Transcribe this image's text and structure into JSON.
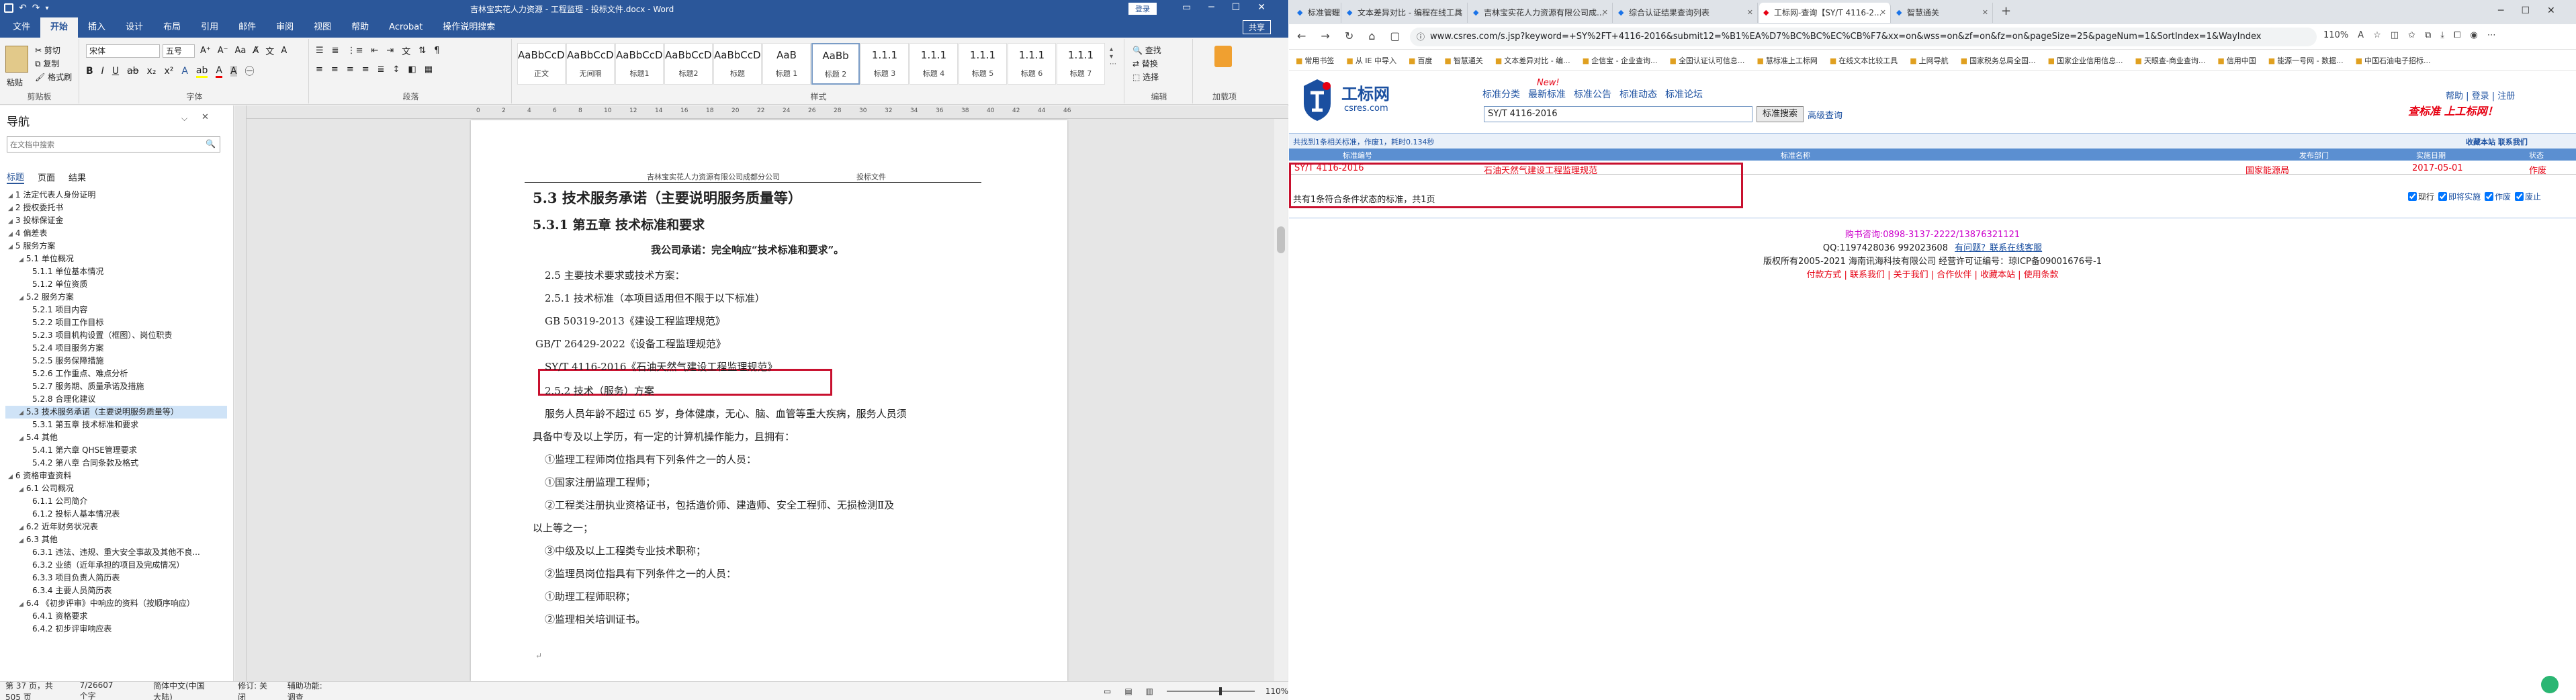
{
  "word": {
    "title_bar": {
      "file_name": "吉林宝实花人力资源 - 工程监理 - 投标文件.docx - Word",
      "login": "登录",
      "share": "共享"
    },
    "tabs": [
      "文件",
      "开始",
      "插入",
      "设计",
      "布局",
      "引用",
      "邮件",
      "审阅",
      "视图",
      "帮助",
      "Acrobat",
      "操作说明搜索"
    ],
    "active_tab": "开始",
    "ribbon": {
      "clipboard": {
        "paste": "粘贴",
        "cut": "剪切",
        "copy": "复制",
        "format_painter": "格式刷",
        "label": "剪贴板"
      },
      "font": {
        "name": "宋体",
        "size": "五号",
        "label": "字体",
        "bold": "B",
        "italic": "I",
        "underline": "U"
      },
      "paragraph": {
        "label": "段落"
      },
      "styles": {
        "label": "样式",
        "items": [
          {
            "sample": "AaBbCcDd",
            "name": "正文"
          },
          {
            "sample": "AaBbCcDd",
            "name": "无间隔"
          },
          {
            "sample": "AaBbCcDd",
            "name": "标题1"
          },
          {
            "sample": "AaBbCcDd",
            "name": "标题2"
          },
          {
            "sample": "AaBbCcDd",
            "name": "标题"
          },
          {
            "sample": "AaB",
            "name": "标题 1"
          },
          {
            "sample": "AaBb",
            "name": "标题 2"
          },
          {
            "sample": "1.1.1",
            "name": "标题 3"
          },
          {
            "sample": "1.1.1",
            "name": "标题 4"
          },
          {
            "sample": "1.1.1",
            "name": "标题 5"
          },
          {
            "sample": "1.1.1",
            "name": "标题 6"
          },
          {
            "sample": "1.1.1",
            "name": "标题 7"
          }
        ]
      },
      "editing": {
        "find": "查找",
        "replace": "替换",
        "select": "选择",
        "label": "编辑"
      },
      "addins": {
        "label": "加载项"
      }
    },
    "nav": {
      "title": "导航",
      "search_placeholder": "在文档中搜索",
      "tabs": [
        "标题",
        "页面",
        "结果"
      ],
      "items": [
        {
          "text": "1 法定代表人身份证明",
          "level": 0,
          "selected": false
        },
        {
          "text": "2 授权委托书",
          "level": 0,
          "selected": false
        },
        {
          "text": "3 投标保证金",
          "level": 0,
          "selected": false
        },
        {
          "text": "4 偏差表",
          "level": 0,
          "selected": false
        },
        {
          "text": "5 服务方案",
          "level": 0,
          "selected": false
        },
        {
          "text": "5.1 单位概况",
          "level": 1,
          "selected": false
        },
        {
          "text": "5.1.1 单位基本情况",
          "level": 2,
          "selected": false
        },
        {
          "text": "5.1.2 单位资质",
          "level": 2,
          "selected": false
        },
        {
          "text": "5.2 服务方案",
          "level": 1,
          "selected": false
        },
        {
          "text": "5.2.1 项目内容",
          "level": 2,
          "selected": false
        },
        {
          "text": "5.2.2 项目工作目标",
          "level": 2,
          "selected": false
        },
        {
          "text": "5.2.3 项目机构设置（框图）、岗位职责",
          "level": 2,
          "selected": false
        },
        {
          "text": "5.2.4 项目服务方案",
          "level": 2,
          "selected": false
        },
        {
          "text": "5.2.5 服务保障措施",
          "level": 2,
          "selected": false
        },
        {
          "text": "5.2.6 工作重点、难点分析",
          "level": 2,
          "selected": false
        },
        {
          "text": "5.2.7 服务期、质量承诺及措施",
          "level": 2,
          "selected": false
        },
        {
          "text": "5.2.8 合理化建议",
          "level": 2,
          "selected": false
        },
        {
          "text": "5.3 技术服务承诺（主要说明服务质量等）",
          "level": 1,
          "selected": true
        },
        {
          "text": "5.3.1 第五章 技术标准和要求",
          "level": 2,
          "selected": false
        },
        {
          "text": "5.4 其他",
          "level": 1,
          "selected": false
        },
        {
          "text": "5.4.1 第六章 QHSE管理要求",
          "level": 2,
          "selected": false
        },
        {
          "text": "5.4.2 第八章 合同条款及格式",
          "level": 2,
          "selected": false
        },
        {
          "text": "6 资格审查资料",
          "level": 0,
          "selected": false
        },
        {
          "text": "6.1 公司概况",
          "level": 1,
          "selected": false
        },
        {
          "text": "6.1.1 公司简介",
          "level": 2,
          "selected": false
        },
        {
          "text": "6.1.2 投标人基本情况表",
          "level": 2,
          "selected": false
        },
        {
          "text": "6.2 近年财务状况表",
          "level": 1,
          "selected": false
        },
        {
          "text": "6.3 其他",
          "level": 1,
          "selected": false
        },
        {
          "text": "6.3.1 违法、违规、重大安全事故及其他不良...",
          "level": 2,
          "selected": false
        },
        {
          "text": "6.3.2 业绩（近年承担的项目及完成情况）",
          "level": 2,
          "selected": false
        },
        {
          "text": "6.3.3 项目负责人简历表",
          "level": 2,
          "selected": false
        },
        {
          "text": "6.3.4 主要人员简历表",
          "level": 2,
          "selected": false
        },
        {
          "text": "6.4 《初步评审》中响应的资料（按顺序响应）",
          "level": 1,
          "selected": false
        },
        {
          "text": "6.4.1 资格要求",
          "level": 2,
          "selected": false
        },
        {
          "text": "6.4.2 初步评审响应表",
          "level": 2,
          "selected": false
        }
      ]
    },
    "document": {
      "header": "吉林宝实花人力资源有限公司成都分公司",
      "header_right": "投标文件",
      "h2": "5.3 技术服务承诺（主要说明服务质量等）",
      "h3": "5.3.1 第五章  技术标准和要求",
      "promise": "我公司承诺：完全响应“技术标准和要求”。",
      "lines": [
        "2.5 主要技术要求或技术方案：",
        "2.5.1 技术标准（本项目适用但不限于以下标准）",
        "GB 50319-2013《建设工程监理规范》",
        "GB/T 26429-2022《设备工程监理规范》",
        "SY/T  4116-2016《石油天然气建设工程监理规范》",
        "2.5.2 技术（服务）方案",
        "服务人员年龄不超过 65 岁，身体健康，无心、脑、血管等重大疾病，服务人员须",
        "具备中专及以上学历，有一定的计算机操作能力，且拥有：",
        "①监理工程师岗位指具有下列条件之一的人员：",
        "①国家注册监理工程师；",
        "②工程类注册执业资格证书，包括造价师、建造师、安全工程师、无损检测Ⅱ及",
        "以上等之一；",
        "③中级及以上工程类专业技术职称；",
        "②监理员岗位指具有下列条件之一的人员：",
        "①助理工程师职称；",
        "②监理相关培训证书。"
      ]
    },
    "status": {
      "page": "第 37 页，共 505 页",
      "words": "7/26607 个字",
      "lang": "简体中文(中国大陆)",
      "track": "修订: 关闭",
      "access": "辅助功能: 调查",
      "zoom": "110%"
    }
  },
  "browser": {
    "tabs": [
      {
        "title": "标准管理 - ",
        "active": false
      },
      {
        "title": "文本差异对比 - 编程在线工具",
        "active": false
      },
      {
        "title": "吉林宝实花人力资源有限公司成...",
        "active": false
      },
      {
        "title": "综合认证结果查询列表",
        "active": false
      },
      {
        "title": "工标网-查询【SY/T 4116-2...",
        "active": true
      },
      {
        "title": "智慧通关",
        "active": false
      }
    ],
    "new_tab": "+",
    "url": "www.csres.com/s.jsp?keyword=+SY%2FT+4116-2016&submit12=%B1%EA%D7%BC%BC%EC%CB%F7&xx=on&wss=on&zf=on&fz=on&pageSize=25&pageNum=1&SortIndex=1&WayIndex",
    "zoom": "110%",
    "bookmarks": [
      "常用书签",
      "从 IE 中导入",
      "百度",
      "智慧通关",
      "文本差异对比 - 编...",
      "企信宝 - 企业查询...",
      "全国认证认可信息...",
      "慧标准上工标网",
      "在线文本比较工具",
      "上网导航",
      "国家税务总局全国...",
      "国家企业信用信息...",
      "天眼查-商业查询...",
      "信用中国",
      "能源一号网 - 数据...",
      "中国石油电子招标..."
    ],
    "site": {
      "logo_cn": "工标网",
      "logo_en": "csres.com",
      "nav": [
        "标准分类",
        "最新标准",
        "标准公告",
        "标准动态",
        "标准论坛"
      ],
      "new_badge": "New!",
      "search_value": "SY/T 4116-2016",
      "search_button": "标准搜索",
      "advanced": "高级查询",
      "top_links": "帮助 | 登录 | 注册",
      "slogan": "查标准  上工标网！",
      "result_summary": "共找到1条相关标准，作废1，耗时0.134秒",
      "result_right": "收藏本站  联系我们",
      "table": {
        "headers": [
          "标准编号",
          "标准名称",
          "发布部门",
          "实施日期",
          "状态"
        ],
        "rows": [
          {
            "code": "SY/T 4116-2016",
            "name": "石油天然气建设工程监理规范",
            "dept": "国家能源局",
            "date": "2017-05-01",
            "status": "作废"
          }
        ]
      },
      "count_text": "共有1条符合条件状态的标准，共1页",
      "filters": [
        "现行",
        "即将实施",
        "作废",
        "废止"
      ],
      "footer": {
        "phone": "购书咨询:0898-3137-2222/13876321121",
        "qq": "QQ:1197428036 992023608",
        "qq_link": "有问题？联系在线客服",
        "copyright": "版权所有2005-2021 海南讯海科技有限公司 经营许可证编号：琼ICP备09001676号-1",
        "links": "付款方式 | 联系我们 | 关于我们 | 合作伙伴 | 收藏本站 | 使用条款"
      }
    }
  },
  "colors": {
    "word_blue": "#2b579a",
    "highlight_red": "#c8102e",
    "site_blue": "#1a4fa0",
    "site_red": "#e60012",
    "site_purple": "#cc00cc"
  }
}
